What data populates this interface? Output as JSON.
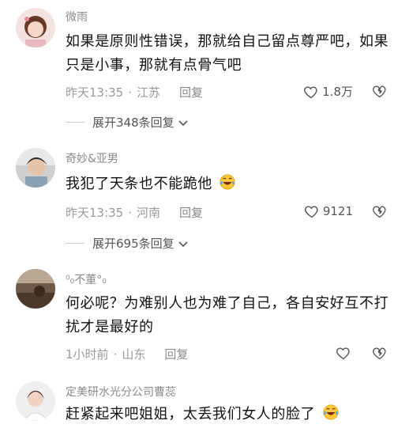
{
  "comments": [
    {
      "username": "微雨",
      "text": "如果是原则性错误，那就给自己留点尊严吧，如果只是小事，那就有点骨气吧",
      "time": "昨天13:35",
      "location": "江苏",
      "reply_label": "回复",
      "likes": "1.8万",
      "expand_label": "展开348条回复"
    },
    {
      "username": "奇妙&亚男",
      "text": "我犯了天条也不能跪他",
      "time": "昨天13:35",
      "location": "河南",
      "reply_label": "回复",
      "likes": "9121",
      "expand_label": "展开695条回复"
    },
    {
      "username": "⁰₀不董°₀",
      "text": "何必呢？为难别人也为难了自己，各自安好互不打扰才是最好的",
      "time": "1小时前",
      "location": "山东",
      "reply_label": "回复",
      "likes": ""
    },
    {
      "username": "定美研水光分公司曹蕊",
      "text": "赶紧起来吧姐姐，太丢我们女人的脸了"
    }
  ],
  "colors": {
    "username": "#8a8a8a",
    "text": "#111111",
    "meta": "#9a9a9a"
  }
}
